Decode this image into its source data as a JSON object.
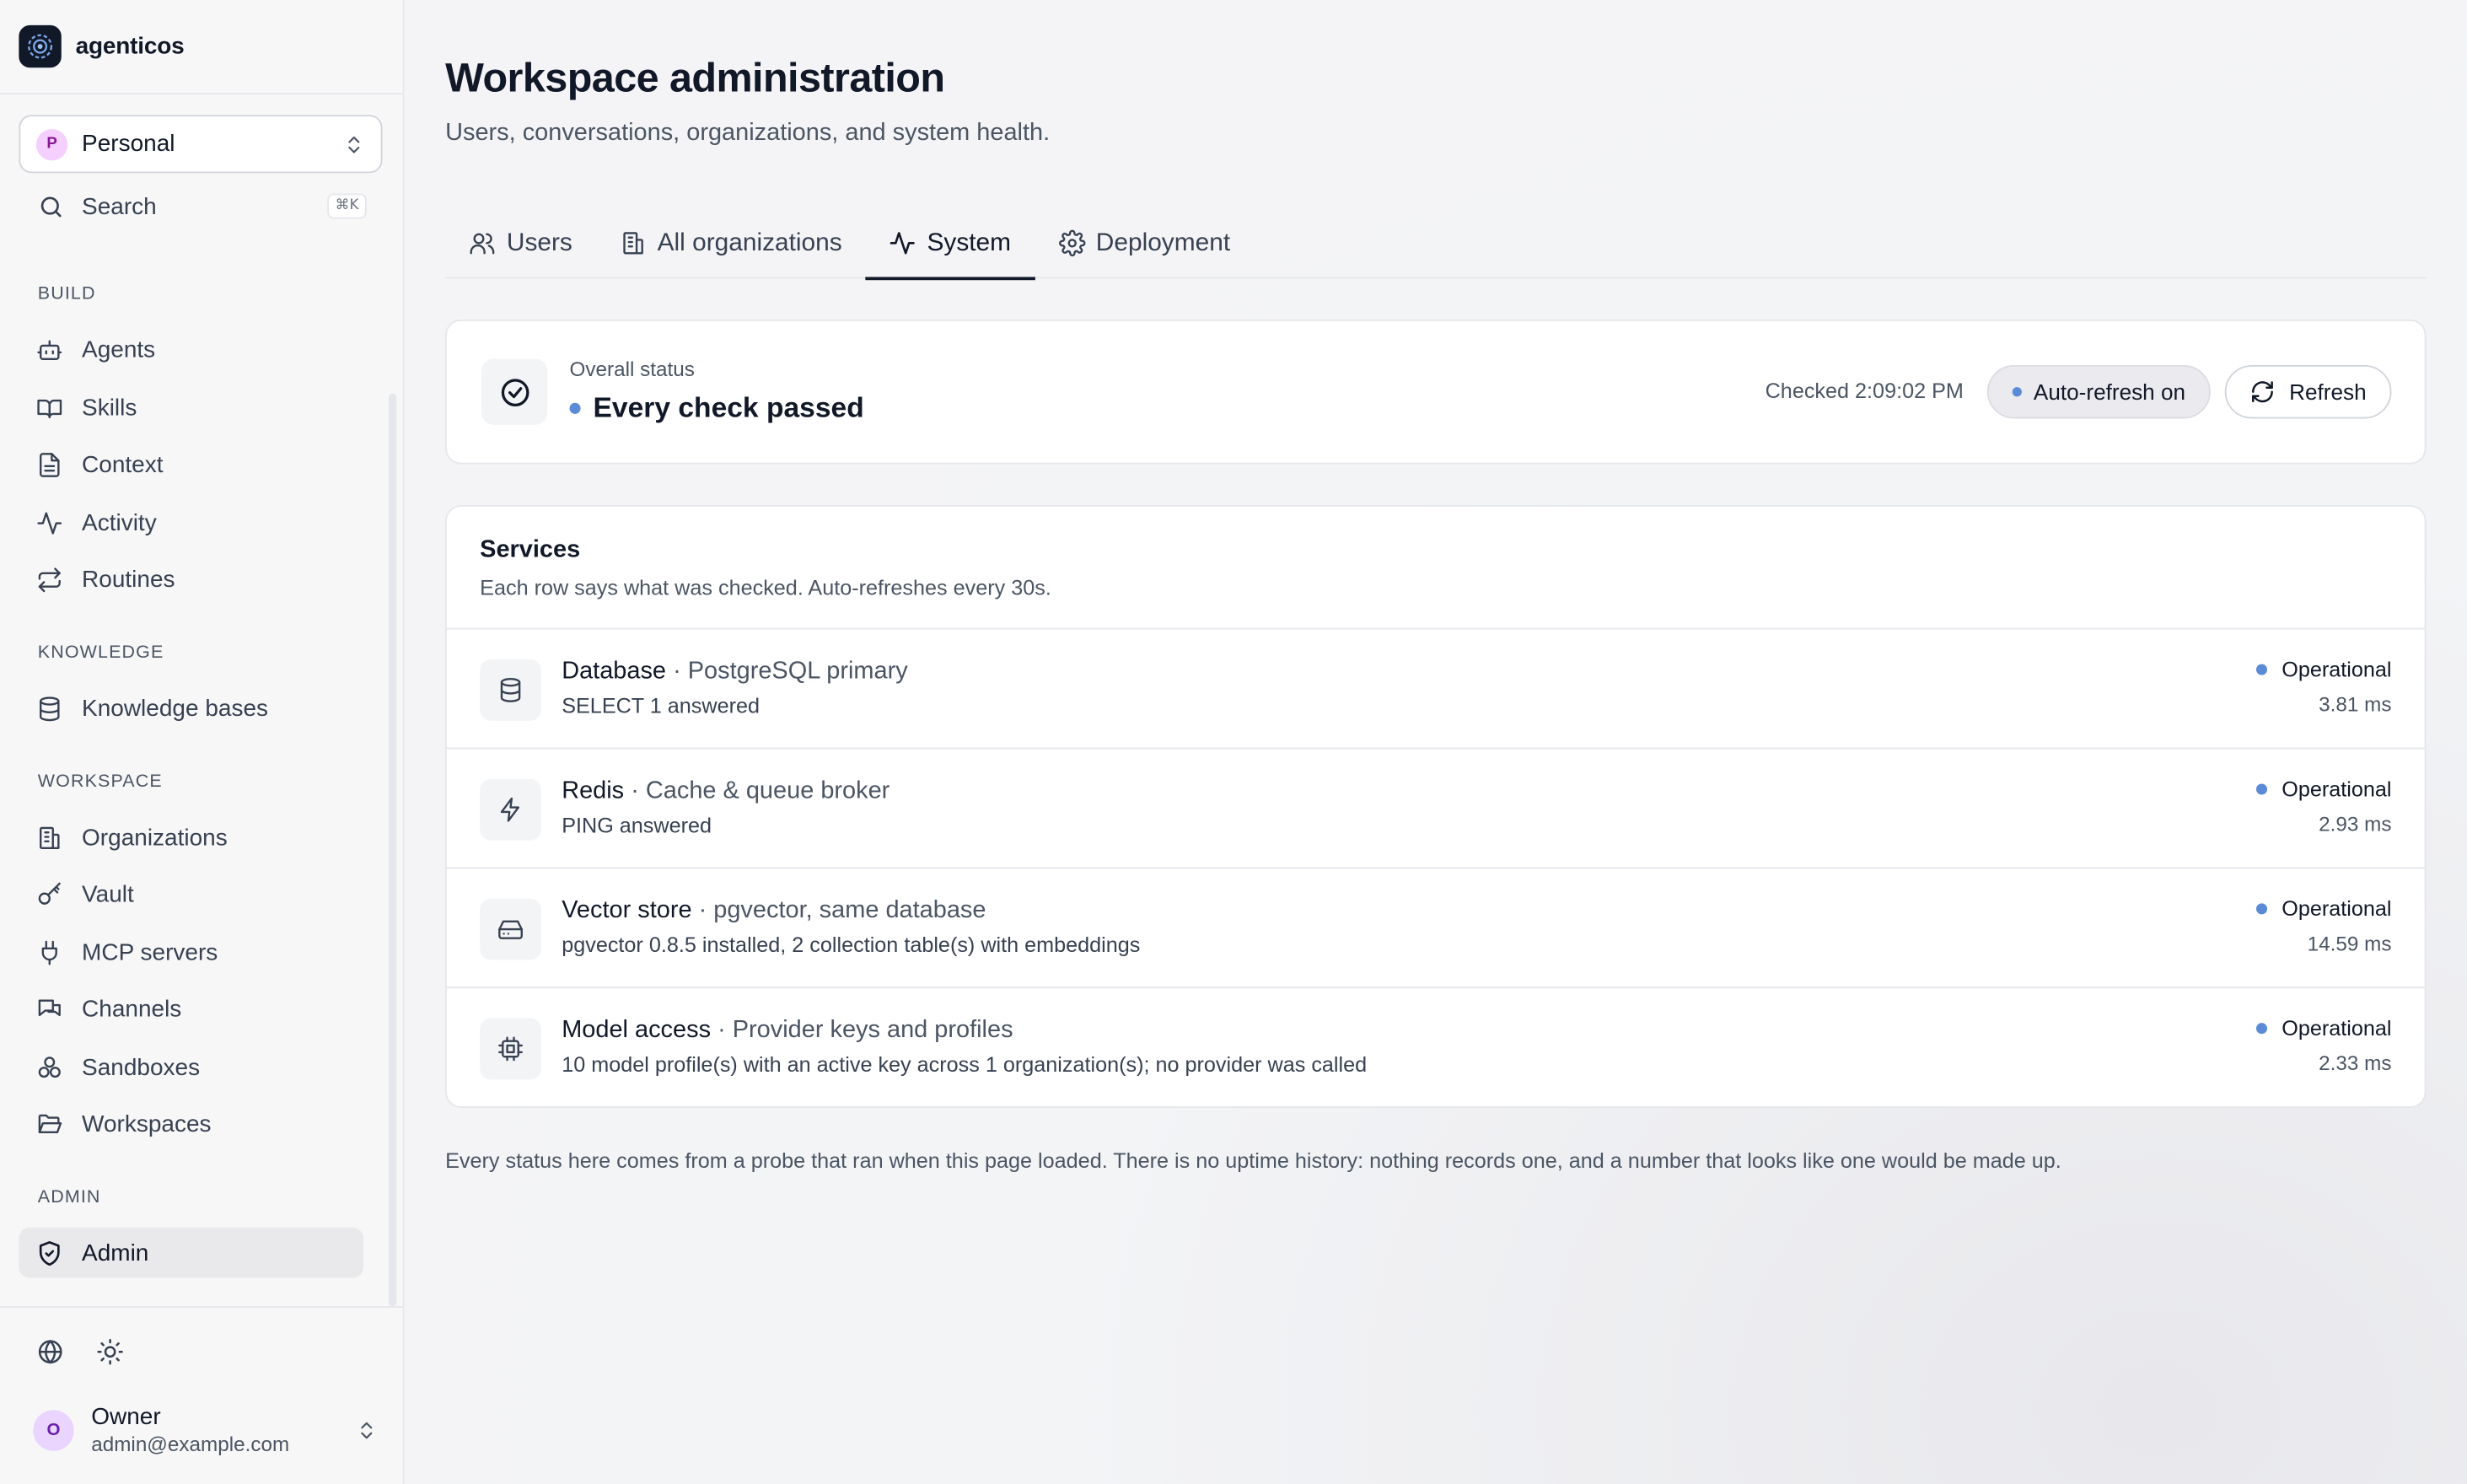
{
  "app": {
    "name": "agenticos"
  },
  "sidebar": {
    "workspace": {
      "initial": "P",
      "name": "Personal"
    },
    "search": {
      "label": "Search",
      "shortcut": "⌘K"
    },
    "sections": {
      "build": "BUILD",
      "knowledge": "KNOWLEDGE",
      "workspace": "WORKSPACE",
      "admin": "ADMIN"
    },
    "items": {
      "agents": "Agents",
      "skills": "Skills",
      "context": "Context",
      "activity": "Activity",
      "routines": "Routines",
      "knowledge_bases": "Knowledge bases",
      "organizations": "Organizations",
      "vault": "Vault",
      "mcp_servers": "MCP servers",
      "channels": "Channels",
      "sandboxes": "Sandboxes",
      "workspaces": "Workspaces",
      "admin": "Admin"
    },
    "active_item": "Admin",
    "user": {
      "initial": "O",
      "name": "Owner",
      "email": "admin@example.com"
    }
  },
  "page": {
    "title": "Workspace administration",
    "subtitle": "Users, conversations, organizations, and system health.",
    "tabs": [
      "Users",
      "All organizations",
      "System",
      "Deployment"
    ],
    "active_tab": "System"
  },
  "overall": {
    "label": "Overall status",
    "value": "Every check passed",
    "checked_at": "Checked 2:09:02 PM",
    "auto_refresh": "Auto-refresh on",
    "refresh": "Refresh"
  },
  "services": {
    "title": "Services",
    "description": "Each row says what was checked. Auto-refreshes every 30s.",
    "rows": [
      {
        "name": "Database",
        "detail": " · PostgreSQL primary",
        "check": "SELECT 1 answered",
        "status": "Operational",
        "latency": "3.81 ms",
        "icon": "database-icon"
      },
      {
        "name": "Redis",
        "detail": " · Cache & queue broker",
        "check": "PING answered",
        "status": "Operational",
        "latency": "2.93 ms",
        "icon": "lightning-icon"
      },
      {
        "name": "Vector store",
        "detail": " · pgvector, same database",
        "check": "pgvector 0.8.5 installed, 2 collection table(s) with embeddings",
        "status": "Operational",
        "latency": "14.59 ms",
        "icon": "hard-drive-icon"
      },
      {
        "name": "Model access",
        "detail": " · Provider keys and profiles",
        "check": "10 model profile(s) with an active key across 1 organization(s); no provider was called",
        "status": "Operational",
        "latency": "2.33 ms",
        "icon": "cpu-chip-icon"
      }
    ]
  },
  "footnote": "Every status here comes from a probe that ran when this page loaded. There is no uptime history: nothing records one, and a number that looks like one would be made up.",
  "colors": {
    "status_dot": "#5b8bd6",
    "active_tab_underline": "#111827",
    "active_nav_bg": "#e9e9ec"
  }
}
